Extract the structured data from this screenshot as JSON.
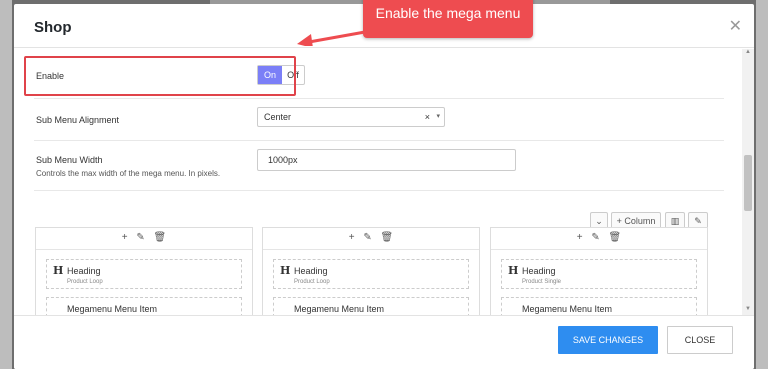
{
  "modal": {
    "title": "Shop",
    "close_icon": "close-icon"
  },
  "callout": {
    "text": "Enable the mega menu"
  },
  "settings": {
    "enable": {
      "label": "Enable",
      "on_label": "On",
      "off_label": "Off",
      "value": "On"
    },
    "alignment": {
      "label": "Sub Menu Alignment",
      "value": "Center",
      "clear": "×",
      "caret": "▾"
    },
    "width": {
      "label": "Sub Menu Width",
      "description": "Controls the max width of the mega menu. In pixels.",
      "value": "1000px"
    }
  },
  "builder": {
    "add_column_label": "Column",
    "columns": [
      {
        "item1": {
          "icon": "H",
          "title": "Heading",
          "subtitle": "Product Loop"
        },
        "item2": {
          "title": "Megamenu Menu Item"
        }
      },
      {
        "item1": {
          "icon": "H",
          "title": "Heading",
          "subtitle": "Product Loop"
        },
        "item2": {
          "title": "Megamenu Menu Item"
        }
      },
      {
        "item1": {
          "icon": "H",
          "title": "Heading",
          "subtitle": "Product Single"
        },
        "item2": {
          "title": "Megamenu Menu Item"
        }
      }
    ]
  },
  "footer": {
    "save_label": "SAVE CHANGES",
    "close_label": "CLOSE"
  },
  "colors": {
    "accent": "#2e8df0",
    "toggle_on": "#7b7ff7",
    "callout": "#ee4c50"
  }
}
